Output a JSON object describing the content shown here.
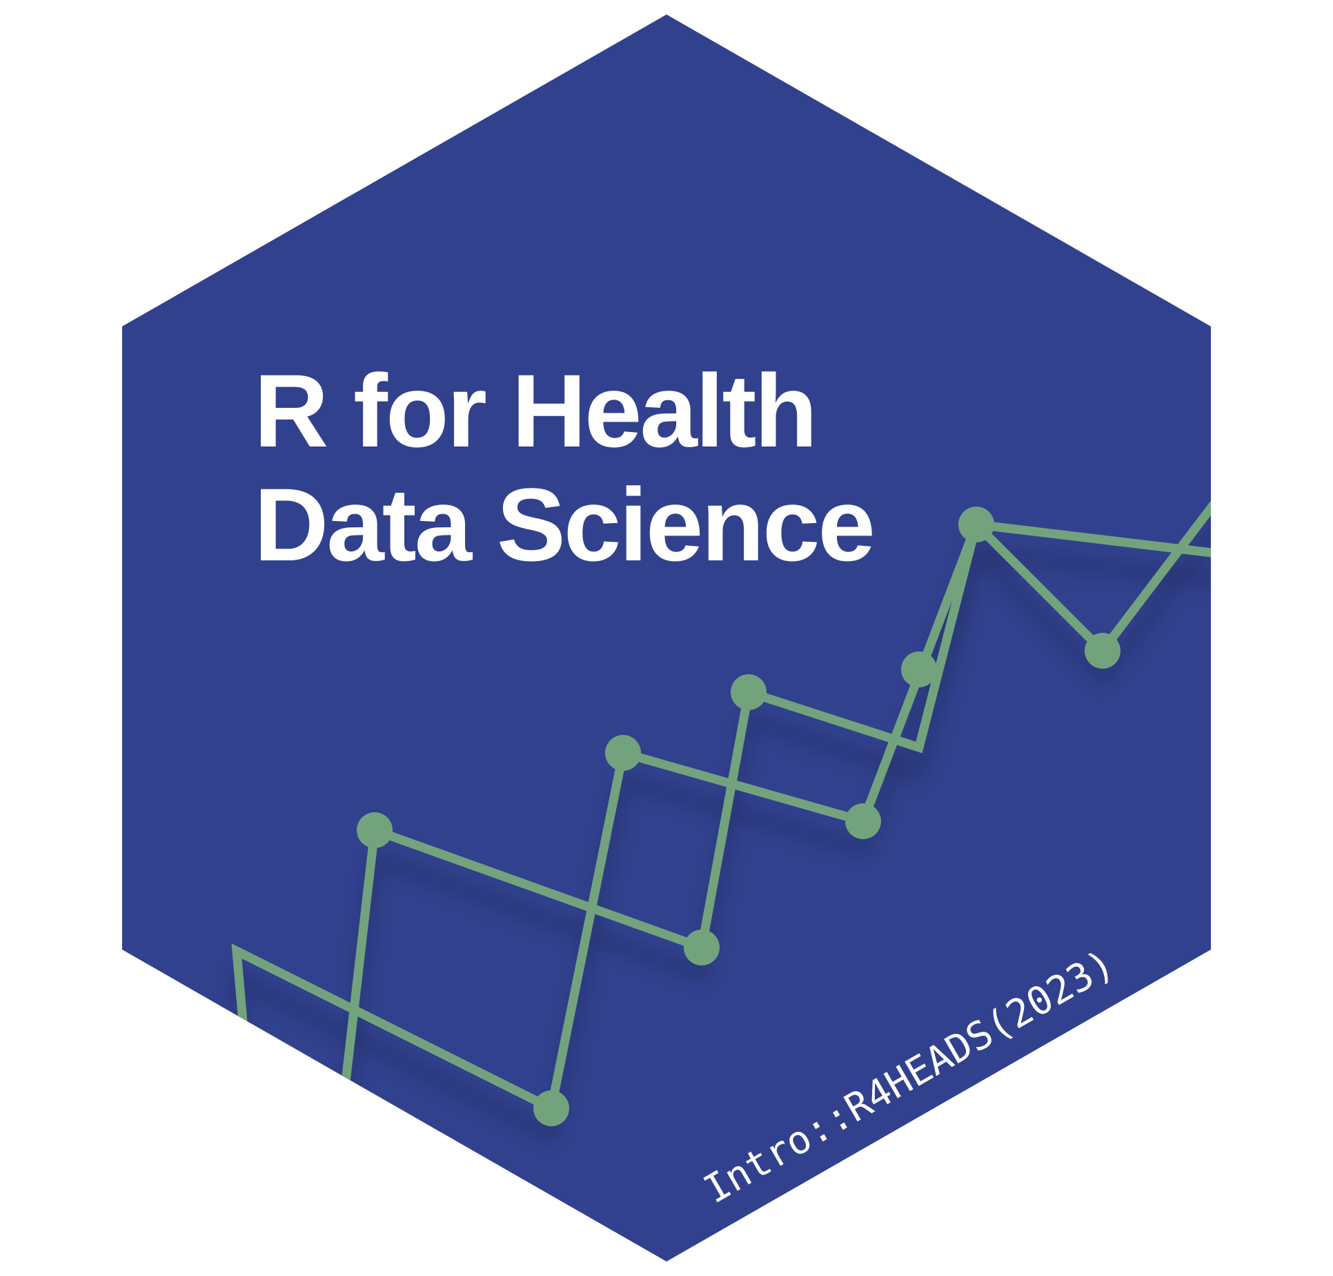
{
  "sticker": {
    "title_line1": "R for Health",
    "title_line2": "Data Science",
    "footer": "Intro::R4HEADS(2023)"
  },
  "colors": {
    "hex_fill": "#31418e",
    "line_color": "#72a37d",
    "text_color": "#ffffff",
    "background": "#ffffff"
  },
  "decoration": {
    "icon": "line-plot-decoration"
  }
}
